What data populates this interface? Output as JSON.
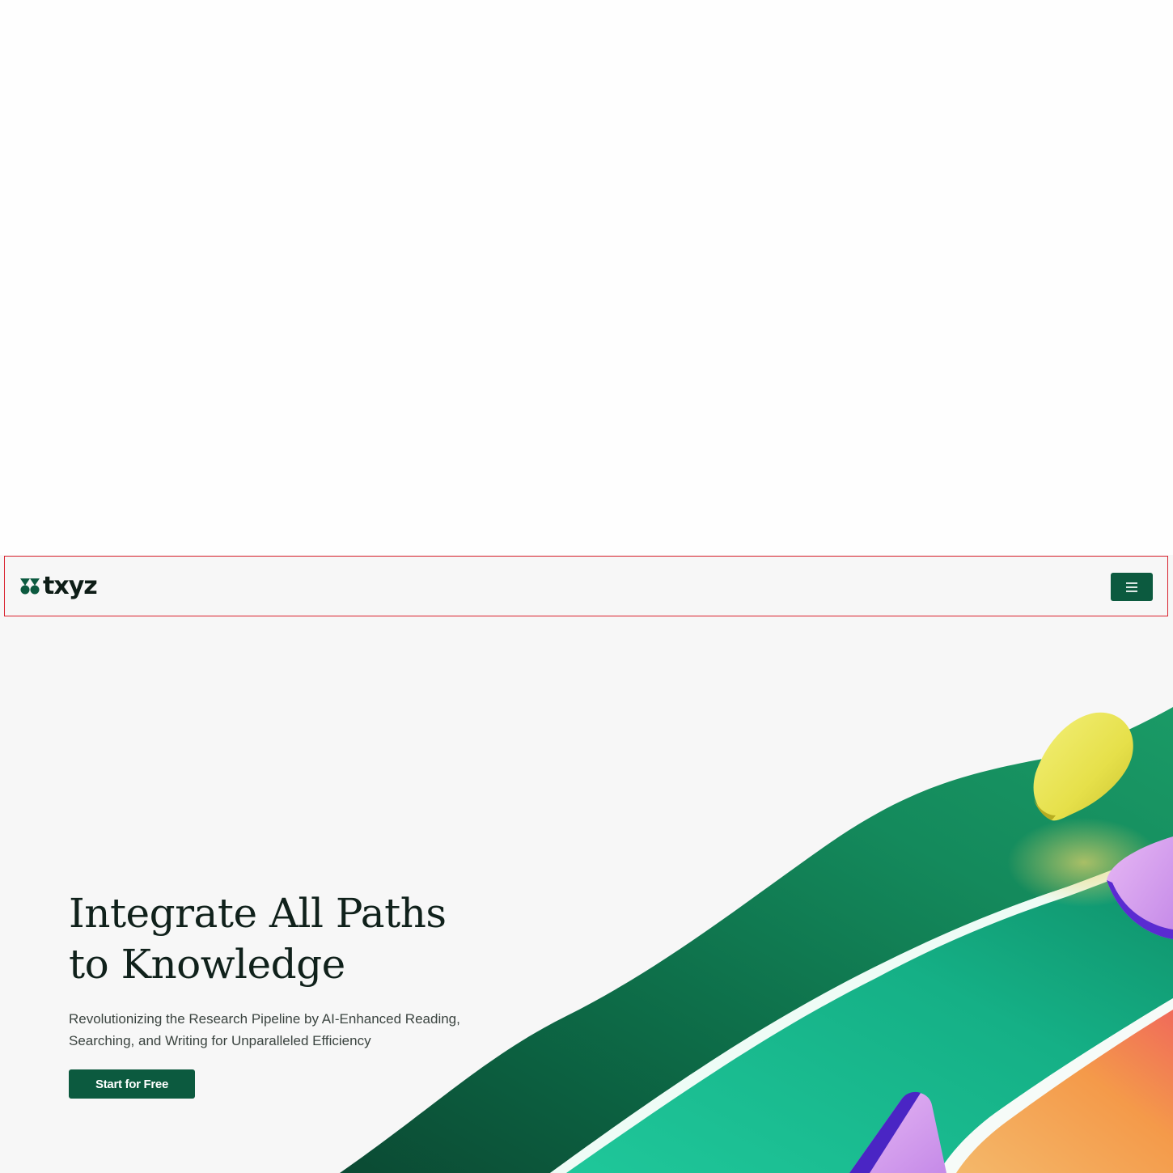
{
  "nav": {
    "logo_text": "txyz",
    "logo_icon": "clover-leaf-icon",
    "menu_icon": "hamburger-menu-icon"
  },
  "hero": {
    "headline_line1": "Integrate All Paths",
    "headline_line2": "to Knowledge",
    "subline": "Revolutionizing the Research Pipeline by AI-Enhanced Reading, Searching, and Writing for Unparalleled Efficiency",
    "cta_label": "Start for Free"
  },
  "colors": {
    "brand_green": "#0c5a3f",
    "highlight_border": "#d9222e",
    "page_bg": "#f7f7f7"
  }
}
